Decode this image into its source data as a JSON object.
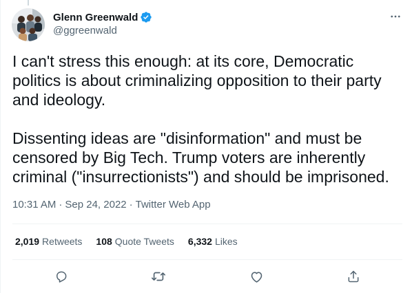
{
  "author": {
    "display_name": "Glenn Greenwald",
    "handle": "@ggreenwald",
    "verified": true
  },
  "tweet": {
    "paragraphs": [
      "I can't stress this enough: at its core, Democratic politics is about criminalizing opposition to their party and ideology.",
      "Dissenting ideas are \"disinformation\" and must be censored by Big Tech. Trump voters are inherently criminal (\"insurrectionists\") and should be imprisoned."
    ],
    "time": "10:31 AM",
    "date": "Sep 24, 2022",
    "source": "Twitter Web App",
    "separator": "·"
  },
  "stats": {
    "retweets_count": "2,019",
    "retweets_label": "Retweets",
    "quotes_count": "108",
    "quotes_label": "Quote Tweets",
    "likes_count": "6,332",
    "likes_label": "Likes"
  },
  "colors": {
    "verified": "#1d9bf0",
    "muted": "#536471",
    "text": "#0f1419",
    "divider": "#eff3f4"
  },
  "icons": {
    "more": "more-horizontal-icon",
    "reply": "reply-icon",
    "retweet": "retweet-icon",
    "like": "like-icon",
    "share": "share-icon"
  }
}
